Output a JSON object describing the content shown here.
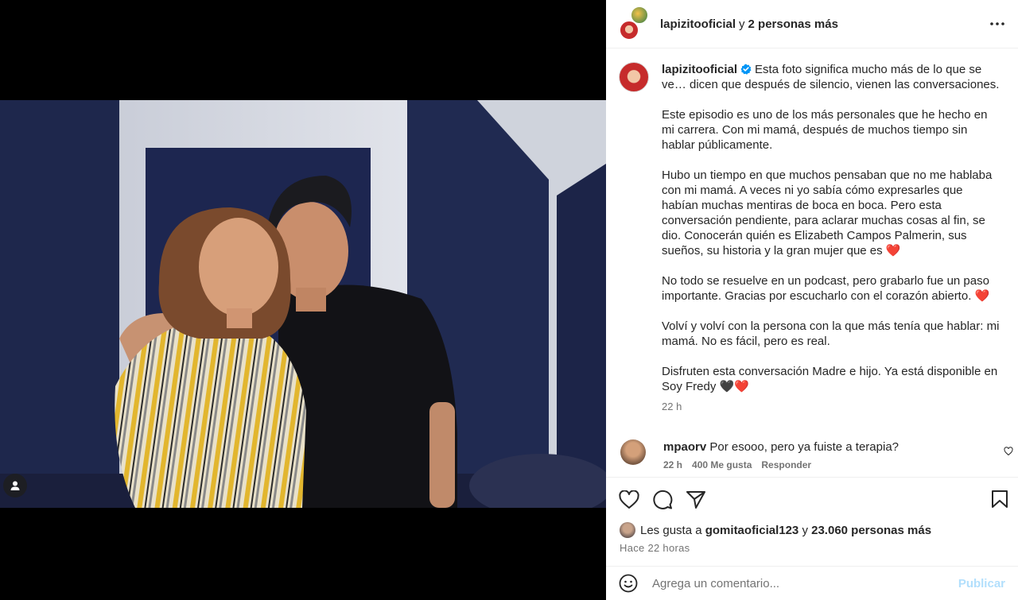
{
  "header": {
    "username": "lapizitooficial",
    "connector": "y",
    "others": "2 personas más"
  },
  "caption": {
    "username": "lapizitooficial",
    "paragraphs": [
      "Esta foto significa mucho más de lo que se ve… dicen que después de silencio, vienen las conversaciones.",
      "Este episodio es uno de los más personales que he hecho en mi carrera. Con mi mamá, después de muchos tiempo sin hablar públicamente.",
      "Hubo un tiempo en que muchos pensaban que no me hablaba con mi mamá. A veces ni yo sabía cómo expresarles que habían muchas mentiras de boca en boca. Pero esta conversación pendiente, para aclarar muchas cosas al fin, se dio. Conocerán quién es Elizabeth Campos Palmerin, sus sueños, su historia y la gran mujer que es ❤️",
      "No todo se resuelve en un podcast, pero grabarlo fue un paso importante. Gracias por escucharlo con el corazón abierto. ❤️",
      "Volví y volví con la persona con la que más tenía que hablar: mi mamá. No es fácil, pero es real.",
      "Disfruten esta conversación Madre e hijo. Ya está disponible en Soy Fredy 🖤❤️"
    ],
    "time": "22 h"
  },
  "comment": {
    "username": "mpaorv",
    "text": "Por esooo, pero ya fuiste a terapia?",
    "time": "22 h",
    "likes": "400 Me gusta",
    "reply": "Responder"
  },
  "likes": {
    "prefix": "Les gusta a",
    "user": "gomitaoficial123",
    "connector": "y",
    "count": "23.060 personas más"
  },
  "timeago": "Hace 22 horas",
  "comment_box": {
    "placeholder": "Agrega un comentario...",
    "publish": "Publicar"
  },
  "icons": {
    "more": "more-horizontal-icon",
    "like": "heart-icon",
    "comment": "comment-bubble-icon",
    "share": "paper-plane-icon",
    "save": "bookmark-icon",
    "emoji": "smiley-icon",
    "tag": "user-tag-icon",
    "verified": "verified-badge-icon"
  },
  "colors": {
    "verified": "#0095f6",
    "publish_disabled": "#b2dffc",
    "secondary_text": "#737373"
  }
}
